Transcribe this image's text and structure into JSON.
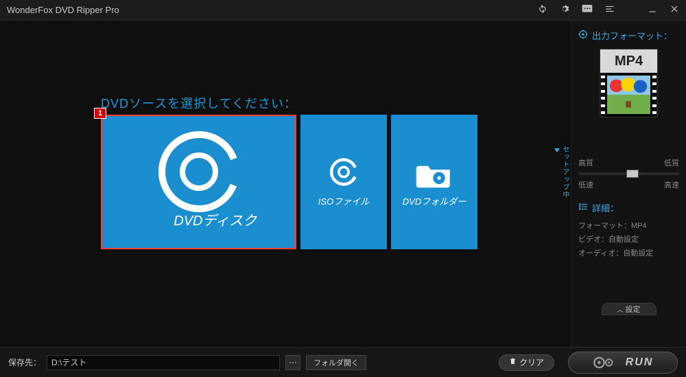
{
  "titlebar": {
    "title": "WonderFox DVD Ripper Pro"
  },
  "main": {
    "prompt": "DVDソースを選択してください：",
    "badge": "1",
    "cards": {
      "disc": "DVDディスク",
      "iso": "ISOファイル",
      "folder": "DVDフォルダー"
    }
  },
  "sidebar": {
    "output_format_label": "出力フォーマット：",
    "format_code": "MP4",
    "quality_high": "高質",
    "quality_low": "低質",
    "speed_slow": "低速",
    "speed_fast": "高速",
    "details_label": "詳細：",
    "detail_format": "フォーマット：MP4",
    "detail_video": "ビデオ：自動設定",
    "detail_audio": "オーディオ：自動設定",
    "settings_label": "設定",
    "vhint": "セットアップ中"
  },
  "bottom": {
    "save_label": "保存先：",
    "path": "D:\\テスト",
    "open_folder": "フォルダ開く",
    "clear": "クリア",
    "run": "RUN"
  }
}
